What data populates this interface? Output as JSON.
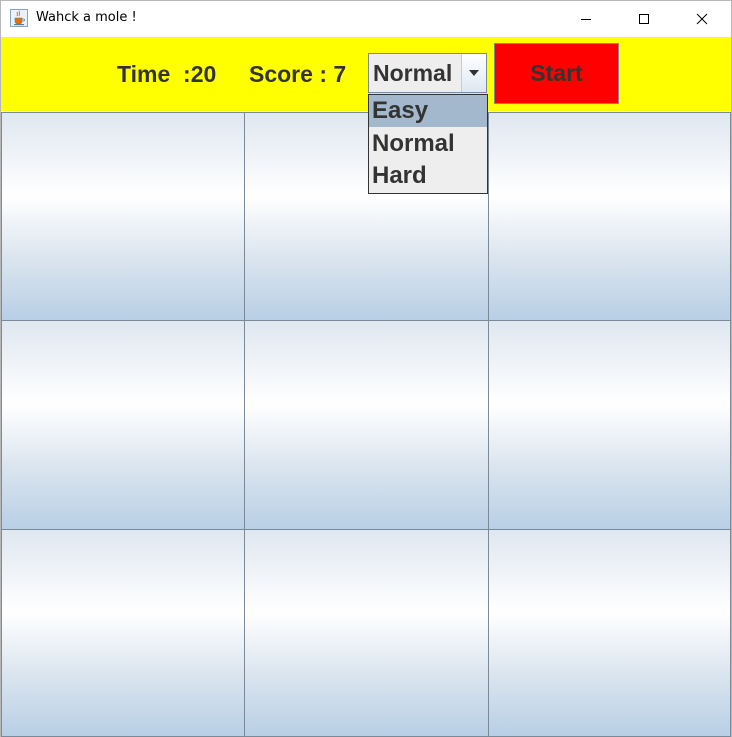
{
  "window": {
    "title": "Wahck a mole !"
  },
  "toolbar": {
    "time_label": "Time  :20",
    "score_label": "Score : 7",
    "difficulty_selected": "Normal",
    "start_label": "Start"
  },
  "difficulty_options": [
    "Easy",
    "Normal",
    "Hard"
  ],
  "highlighted_option": "Easy",
  "grid": {
    "rows": 3,
    "columns": 3
  },
  "colors": {
    "toolbar_bg": "#ffff00",
    "start_button_bg": "#ff0000",
    "text": "#333333",
    "cell_gradient_bottom": "#b8cfe5",
    "dropdown_highlight": "#a3b8cc"
  },
  "icons": {
    "app": "java-cup-icon",
    "minimize": "minimize-icon",
    "maximize": "maximize-icon",
    "close": "close-icon",
    "dropdown": "chevron-down-icon"
  }
}
